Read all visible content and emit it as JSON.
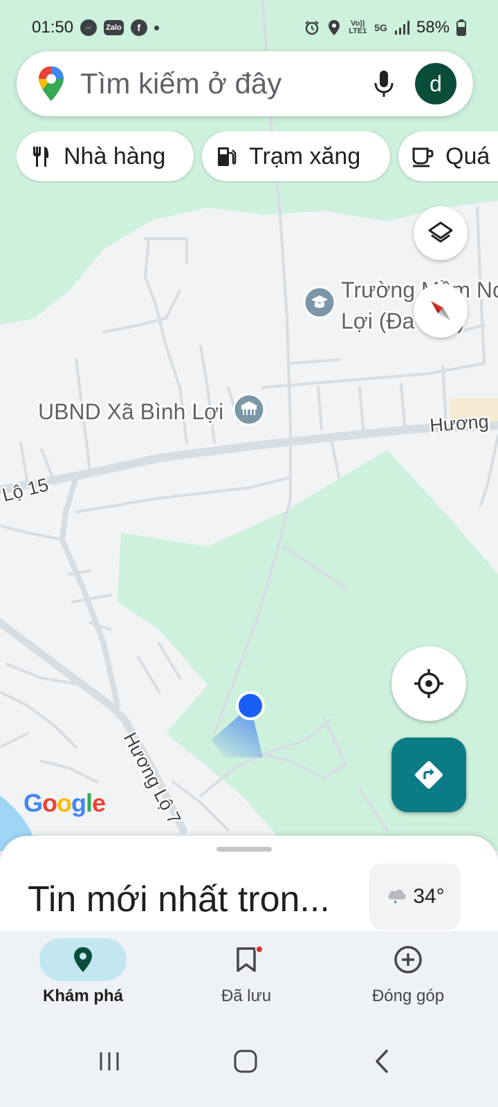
{
  "status_bar": {
    "time": "01:50",
    "notification_icons": [
      "messenger-icon",
      "zalo-icon",
      "facebook-icon",
      "dot-icon"
    ],
    "zalo_text": "Zalo",
    "system_icons": [
      "alarm-icon",
      "location-icon",
      "volte-icon",
      "5g-icon",
      "signal-icon",
      "battery-icon"
    ],
    "volte_text": "Vo)) LTE1",
    "network_text": "5G",
    "battery": "58%"
  },
  "search": {
    "placeholder": "Tìm kiếm ở đây",
    "avatar_letter": "d"
  },
  "chips": [
    {
      "label": "Nhà hàng",
      "icon": "restaurant-icon"
    },
    {
      "label": "Trạm xăng",
      "icon": "gas-station-icon"
    },
    {
      "label": "Quá",
      "icon": "cafe-icon"
    }
  ],
  "map": {
    "places": [
      {
        "name": "Trường Mầm Non Bình Lợi (Đa Tây)",
        "line1": "Trường Mầm Non",
        "line2": "Lợi (Đa Tây)",
        "icon": "school-icon"
      },
      {
        "name": "UBND Xã Bình Lợi",
        "icon": "government-icon"
      }
    ],
    "road_labels": [
      "Lộ 15",
      "Hương",
      "Hương Lộ 7"
    ],
    "colors": {
      "land": "#f1f3f4",
      "park": "#cdf1dc",
      "road": "#d6dde3",
      "water": "#9fd6f5",
      "location_dot": "#1a5ff5",
      "directions": "#0b7b86"
    },
    "attribution": "Google"
  },
  "controls": {
    "layers": "layers-icon",
    "compass": "compass-icon",
    "my_location": "my-location-icon",
    "directions": "directions-icon"
  },
  "sheet": {
    "title": "Tin mới nhất tron...",
    "weather_temp": "34°",
    "weather_icon": "rain-cloud-icon"
  },
  "bottom_nav": [
    {
      "label": "Khám phá",
      "icon": "explore-pin-icon",
      "active": true
    },
    {
      "label": "Đã lưu",
      "icon": "bookmark-icon",
      "active": false
    },
    {
      "label": "Đóng góp",
      "icon": "add-circle-icon",
      "active": false
    }
  ],
  "system_nav": [
    "recents-icon",
    "home-icon",
    "back-icon"
  ]
}
